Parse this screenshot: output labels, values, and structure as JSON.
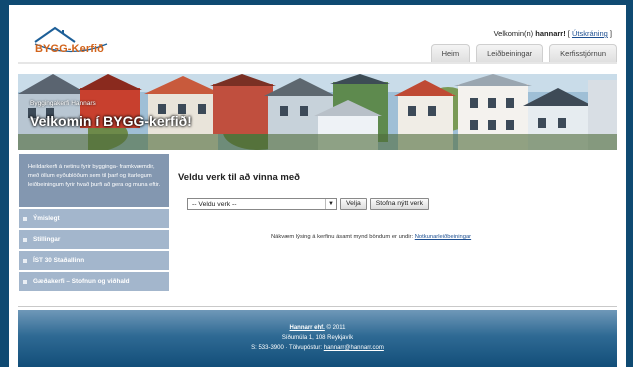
{
  "brand": {
    "logo_text": "BYGG-Kerfið",
    "accent_color": "#d2641c",
    "logo_icon": "house-icon"
  },
  "header": {
    "welcome_prefix": "Velkomin(n)",
    "user": "hannarr!",
    "logout_label": "Útskráning"
  },
  "topnav": [
    "Heim",
    "Leiðbeiningar",
    "Kerfisstjórnun"
  ],
  "banner": {
    "crumb": "Byggingakerfi Hannars",
    "title": "Velkomin í BYGG-kerfið!"
  },
  "sidebar": {
    "intro": "Heildarkerfi á netinu fyrir bygginga- framkvæmdir, með öllum eyðublöðum sem til þarf og ítarlegum leiðbeiningum fyrir hvað þurfi að gera og muna eftir.",
    "items": [
      {
        "label": "Ýmislegt"
      },
      {
        "label": "Stillingar"
      },
      {
        "label": "ÍST 30 Staðallinn"
      },
      {
        "label": "Gæðakerfi – Stofnun og viðhald"
      }
    ]
  },
  "main": {
    "title": "Veldu verk til að vinna með",
    "select_value": "-- Veldu verk --",
    "select_button": "Velja",
    "create_button": "Stofna nýtt verk",
    "info_text": "Nákvæm lýsing á kerfinu ásamt mynd böndum er undir:",
    "info_link": "Notkunarleiðbeiningar"
  },
  "footer": {
    "company": "Hannarr ehf.",
    "copyright": "© 2011",
    "address": "Síðumúla 1, 108 Reykjavík",
    "contact_prefix": "S: 533-3900 · Tölvupóstur:",
    "email": "hannarr@hannarr.com"
  }
}
